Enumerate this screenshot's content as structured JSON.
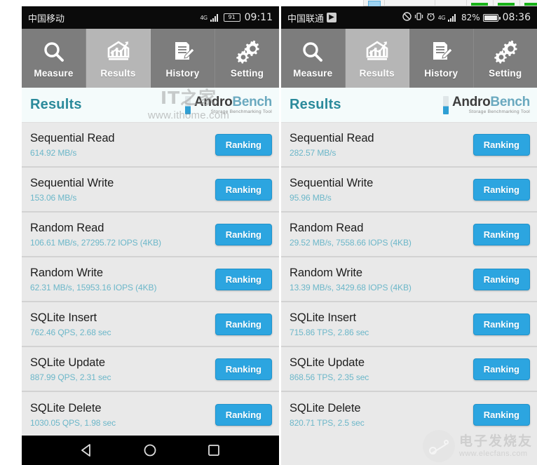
{
  "top_strip": {
    "present": true
  },
  "phones": [
    {
      "id": "left",
      "statusbar": {
        "carrier": "中国移动",
        "badge": "",
        "signal_label": "4G",
        "battery_text": "91",
        "time": "09:11"
      },
      "tabs": [
        {
          "label": "Measure",
          "icon": "magnifier-icon",
          "active": false
        },
        {
          "label": "Results",
          "icon": "bar-chart-icon",
          "active": true
        },
        {
          "label": "History",
          "icon": "document-edit-icon",
          "active": false
        },
        {
          "label": "Setting",
          "icon": "gears-icon",
          "active": false
        }
      ],
      "header": {
        "title": "Results",
        "brand_a": "Andro",
        "brand_b": "Bench",
        "brand_sub": "Storage Benchmarking Tool"
      },
      "rows": [
        {
          "name": "Sequential Read",
          "value": "614.92 MB/s",
          "button": "Ranking"
        },
        {
          "name": "Sequential Write",
          "value": "153.06 MB/s",
          "button": "Ranking"
        },
        {
          "name": "Random Read",
          "value": "106.61 MB/s, 27295.72 IOPS (4KB)",
          "button": "Ranking"
        },
        {
          "name": "Random Write",
          "value": "62.31 MB/s, 15953.16 IOPS (4KB)",
          "button": "Ranking"
        },
        {
          "name": "SQLite Insert",
          "value": "762.46 QPS, 2.68 sec",
          "button": "Ranking"
        },
        {
          "name": "SQLite Update",
          "value": "887.99 QPS, 2.31 sec",
          "button": "Ranking"
        },
        {
          "name": "SQLite Delete",
          "value": "1030.05 QPS, 1.98 sec",
          "button": "Ranking"
        }
      ],
      "navbar": {
        "back": "back-triangle-icon",
        "home": "home-circle-icon",
        "recents": "recents-square-icon"
      }
    },
    {
      "id": "right",
      "statusbar": {
        "carrier": "中国联通",
        "badge": "▶",
        "signal_label": "4G",
        "battery_text": "82%",
        "time": "08:36"
      },
      "tabs": [
        {
          "label": "Measure",
          "icon": "magnifier-icon",
          "active": false
        },
        {
          "label": "Results",
          "icon": "bar-chart-icon",
          "active": true
        },
        {
          "label": "History",
          "icon": "document-edit-icon",
          "active": false
        },
        {
          "label": "Setting",
          "icon": "gears-icon",
          "active": false
        }
      ],
      "header": {
        "title": "Results",
        "brand_a": "Andro",
        "brand_b": "Bench",
        "brand_sub": "Storage Benchmarking Tool"
      },
      "rows": [
        {
          "name": "Sequential Read",
          "value": "282.57 MB/s",
          "button": "Ranking"
        },
        {
          "name": "Sequential Write",
          "value": "95.96 MB/s",
          "button": "Ranking"
        },
        {
          "name": "Random Read",
          "value": "29.52 MB/s, 7558.66 IOPS (4KB)",
          "button": "Ranking"
        },
        {
          "name": "Random Write",
          "value": "13.39 MB/s, 3429.68 IOPS (4KB)",
          "button": "Ranking"
        },
        {
          "name": "SQLite Insert",
          "value": "715.86 TPS, 2.86 sec",
          "button": "Ranking"
        },
        {
          "name": "SQLite Update",
          "value": "868.56 TPS, 2.35 sec",
          "button": "Ranking"
        },
        {
          "name": "SQLite Delete",
          "value": "820.71 TPS, 2.5 sec",
          "button": "Ranking"
        }
      ]
    }
  ],
  "watermarks": {
    "ithome_logo": "IT之家",
    "ithome_url": "www.ithome.com",
    "elecfans_cn": "电子发烧友",
    "elecfans_url": "www.elecfans.com"
  },
  "colors": {
    "accent_button": "#2ca5e0",
    "value_text": "#6cb7c9",
    "title_text": "#2b8a9b",
    "tabbar_bg": "#7d7d7d",
    "tab_active_bg": "#b6b6b6",
    "row_bg": "#e9e9e9",
    "statusbar_bg": "#0b0b0b"
  }
}
